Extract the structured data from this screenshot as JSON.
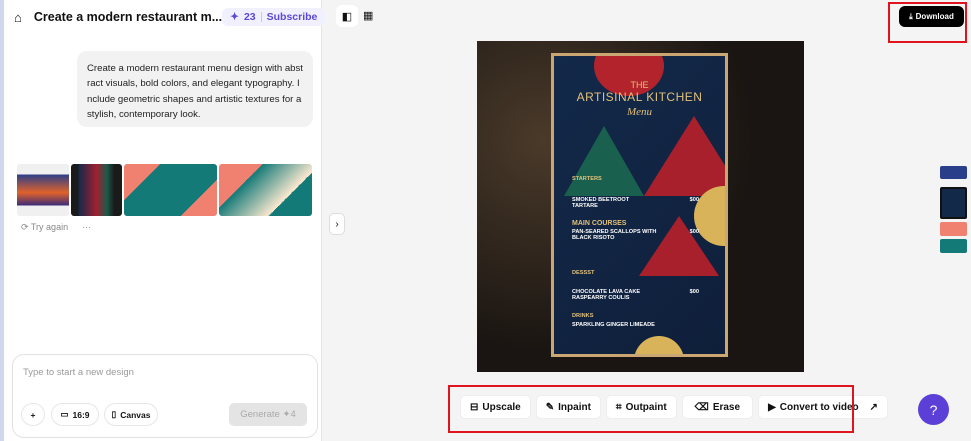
{
  "header": {
    "title": "Create a modern restaurant m...",
    "credits": "23",
    "subscribe": "Subscribe",
    "home_icon": "home-icon"
  },
  "prompt": {
    "text": "Create a modern restaurant menu design with abstract visuals, bold colors, and elegant typography. Include geometric shapes and artistic textures for a stylish, contemporary look."
  },
  "results": {
    "try_again": "Try again",
    "more": "···"
  },
  "composer": {
    "placeholder": "Type to start a new design",
    "plus": "+",
    "ratio": "16:9",
    "canvas": "Canvas",
    "generate": "Generate",
    "generate_cost": "4"
  },
  "toolbar": {
    "download": "Download"
  },
  "menu_image": {
    "title_line1": "THE",
    "title_line2": "ARTISINAL KITCHEN",
    "subtitle": "Menu",
    "starters": "STARTERS",
    "item1": "SMOKED BEETROOT TARTARE",
    "main": "MAIN COURSES",
    "item2": "PAN-SEARED SCALLOPS WITH BLACK RISOTO",
    "desserts": "DESSST",
    "item3": "CHOCOLATE LAVA CAKE RASPEARRY COULIS",
    "drinks": "DRINKS",
    "item4": "SPARKLING GINGER LIMEADE",
    "price": "$00"
  },
  "actions": [
    {
      "label": "Upscale",
      "icon": "upscale-icon"
    },
    {
      "label": "Inpaint",
      "icon": "brush-icon"
    },
    {
      "label": "Outpaint",
      "icon": "outpaint-icon"
    },
    {
      "label": "Erase",
      "icon": "eraser-icon"
    },
    {
      "label": "Convert to video",
      "icon": "video-icon"
    }
  ],
  "colors": {
    "accent": "#5b3fd6",
    "highlight": "#e0141e"
  }
}
